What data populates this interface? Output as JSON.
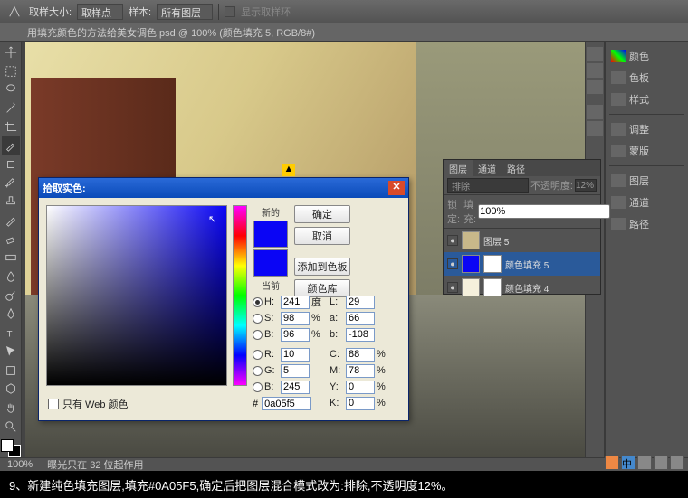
{
  "topbar": {
    "label1": "取样大小:",
    "dropdown1": "取样点",
    "label2": "样本:",
    "dropdown2": "所有图层",
    "checkbox_label": "显示取样环"
  },
  "doc_title": "用填充颜色的方法给美女调色.psd @ 100% (颜色填充 5, RGB/8#)",
  "right_tabs": [
    "颜色",
    "色板",
    "样式",
    "调整",
    "蒙版",
    "图层",
    "通道",
    "路径"
  ],
  "layers": {
    "tabs": [
      "图层",
      "通道",
      "路径"
    ],
    "blend_mode": "排除",
    "opacity_label": "不透明度:",
    "opacity": "12%",
    "lock_label": "锁定:",
    "fill_label": "填充:",
    "fill": "100%",
    "items": [
      {
        "name": "图层 5",
        "thumb": "#c8b88a"
      },
      {
        "name": "颜色填充 5",
        "thumb": "#0a05f5",
        "selected": true
      },
      {
        "name": "颜色填充 4",
        "thumb": "#f5f0dc"
      }
    ]
  },
  "picker": {
    "title": "拾取实色:",
    "new_label": "新的",
    "current_label": "当前",
    "new_color": "#0a05f5",
    "current_color": "#0a05f5",
    "btn_ok": "确定",
    "btn_cancel": "取消",
    "btn_add": "添加到色板",
    "btn_lib": "颜色库",
    "H": "241",
    "H_unit": "度",
    "S": "98",
    "B": "96",
    "R": "10",
    "G": "5",
    "Bv": "245",
    "L": "29",
    "a": "66",
    "b": "-108",
    "C": "88",
    "M": "78",
    "Y": "0",
    "K": "0",
    "hex": "0a05f5",
    "web_label": "只有 Web 颜色"
  },
  "status": {
    "zoom": "100%",
    "info": "曝光只在 32 位起作用"
  },
  "caption": "9、新建纯色填充图层,填充#0A05F5,确定后把图层混合模式改为:排除,不透明度12%。"
}
